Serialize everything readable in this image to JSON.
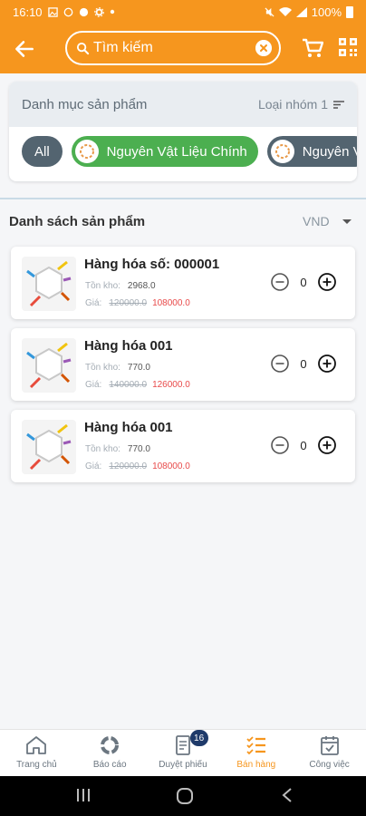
{
  "status": {
    "time": "16:10",
    "battery": "100%"
  },
  "search": {
    "placeholder": "Tìm kiếm"
  },
  "categories": {
    "title": "Danh mục sản phẩm",
    "filter_label": "Loại nhóm 1",
    "chips": [
      {
        "label": "All"
      },
      {
        "label": "Nguyên Vật Liệu Chính"
      },
      {
        "label": "Nguyên Vậ"
      }
    ]
  },
  "list": {
    "title": "Danh sách sản phẩm",
    "currency": "VND"
  },
  "labels": {
    "stock": "Tồn kho:",
    "price": "Giá:"
  },
  "products": [
    {
      "name": "Hàng hóa số: 000001",
      "stock": "2968.0",
      "old_price": "120000.0",
      "new_price": "108000.0",
      "qty": "0"
    },
    {
      "name": "Hàng hóa 001",
      "stock": "770.0",
      "old_price": "140000.0",
      "new_price": "126000.0",
      "qty": "0"
    },
    {
      "name": "Hàng hóa 001",
      "stock": "770.0",
      "old_price": "120000.0",
      "new_price": "108000.0",
      "qty": "0"
    }
  ],
  "nav": {
    "items": [
      {
        "label": "Trang chủ",
        "icon": "home-icon"
      },
      {
        "label": "Báo cáo",
        "icon": "report-icon"
      },
      {
        "label": "Duyệt phiếu",
        "icon": "document-icon",
        "badge": "16"
      },
      {
        "label": "Bán hàng",
        "icon": "checklist-icon"
      },
      {
        "label": "Công việc",
        "icon": "calendar-check-icon"
      }
    ]
  },
  "colors": {
    "primary": "#f6961e",
    "green": "#4caf50",
    "slate": "#536470",
    "price_red": "#e84a4a"
  }
}
